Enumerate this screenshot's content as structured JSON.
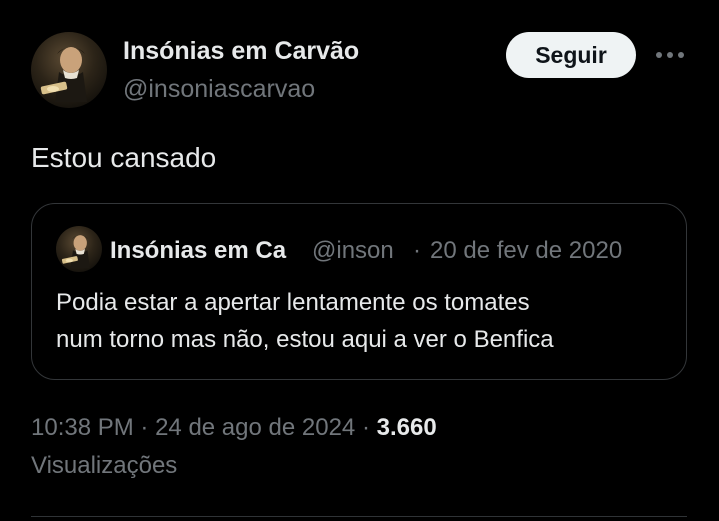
{
  "author": {
    "name": "Insónias em Carvão",
    "handle": "@insoniascarvao"
  },
  "follow_button": {
    "label": "Seguir"
  },
  "more_icon": "more-horizontal-icon",
  "tweet": {
    "text": "Estou cansado"
  },
  "quoted_tweet": {
    "name": "Insónias em Ca",
    "handle": "@inson",
    "separator": "·",
    "date": "20 de fev de 2020",
    "lines": [
      "Podia estar a apertar lentamente os tomates",
      "num torno mas não, estou aqui a ver o Benfica"
    ]
  },
  "meta": {
    "time": "10:38 PM",
    "separator": "·",
    "date": "24 de ago de 2024",
    "views_count": "3.660",
    "views_label": "Visualizações"
  },
  "colors": {
    "background": "#000000",
    "text_primary": "#e7e9ea",
    "text_secondary": "#71767b",
    "border": "#333639",
    "button_bg": "#eff3f4"
  }
}
